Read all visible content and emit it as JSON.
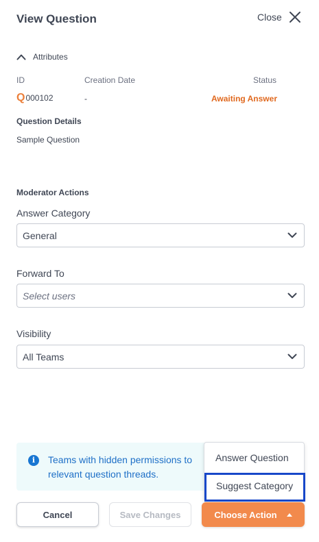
{
  "header": {
    "title": "View Question",
    "close_label": "Close"
  },
  "attributes": {
    "toggle_label": "Attributes",
    "columns": {
      "id": "ID",
      "creation_date": "Creation Date",
      "status": "Status"
    },
    "id_prefix": "Q",
    "id_number": "000102",
    "creation_date": "-",
    "status": "Awaiting Answer"
  },
  "question_details": {
    "title": "Question Details",
    "text": "Sample Question"
  },
  "moderator": {
    "title": "Moderator Actions",
    "answer_category": {
      "label": "Answer Category",
      "value": "General"
    },
    "forward_to": {
      "label": "Forward To",
      "placeholder": "Select users"
    },
    "visibility": {
      "label": "Visibility",
      "value": "All Teams"
    }
  },
  "info": {
    "icon": "i",
    "text": "Teams with hidden permissions to relevant question threads."
  },
  "action_menu": {
    "items": [
      "Answer Question",
      "Suggest Category"
    ],
    "selected_index": 1
  },
  "footer": {
    "cancel": "Cancel",
    "save": "Save Changes",
    "choose_action": "Choose Action"
  },
  "colors": {
    "accent": "#f28a4c",
    "status": "#e0691f",
    "info_text": "#1e6fc7",
    "highlight_border": "#1747c9"
  }
}
